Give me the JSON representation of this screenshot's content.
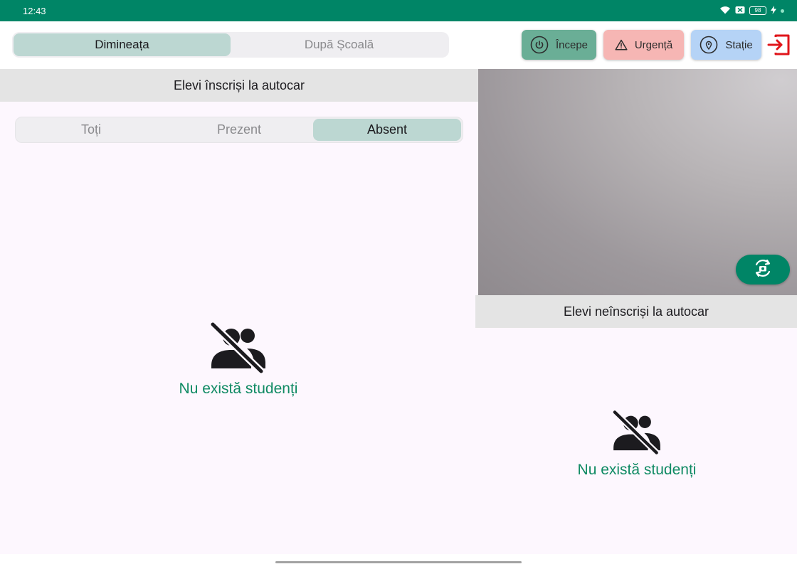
{
  "status_bar": {
    "time": "12:43",
    "battery": "98"
  },
  "shift_tabs": [
    {
      "label": "Dimineața",
      "active": true
    },
    {
      "label": "După Școală",
      "active": false
    }
  ],
  "actions": {
    "start_label": "Începe",
    "urgent_label": "Urgență",
    "station_label": "Stație"
  },
  "left_panel": {
    "title": "Elevi înscriși la autocar",
    "filters": [
      {
        "label": "Toți",
        "active": false
      },
      {
        "label": "Prezent",
        "active": false
      },
      {
        "label": "Absent",
        "active": true
      }
    ],
    "empty_text": "Nu există studenți"
  },
  "right_panel": {
    "title": "Elevi neînscriși la autocar",
    "empty_text": "Nu există studenți"
  },
  "colors": {
    "status_bar": "#008566",
    "start": "#6aae96",
    "urgent": "#f6b6b4",
    "station": "#b5d3f6",
    "exit": "#e0161b",
    "empty_text": "#0f8a63",
    "active_segment": "#bcd7d2"
  }
}
